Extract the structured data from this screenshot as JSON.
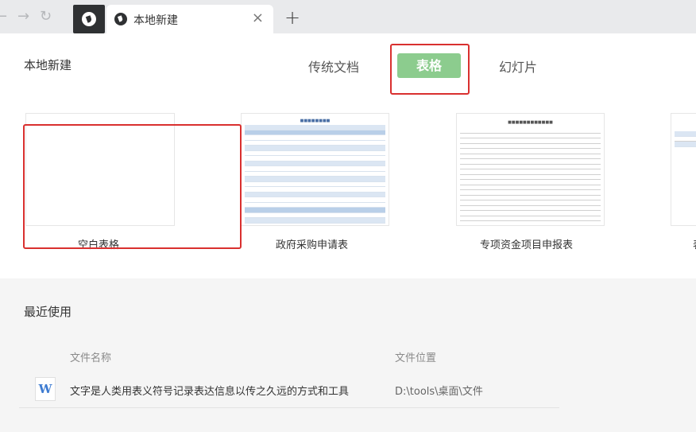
{
  "browser": {
    "tab_title": "本地新建",
    "icons": {
      "back": "back-arrow-icon",
      "forward": "forward-arrow-icon",
      "reload": "reload-icon",
      "close": "close-icon",
      "new_tab": "plus-icon"
    }
  },
  "header": {
    "title": "本地新建",
    "doc_tabs": [
      {
        "label": "传统文档"
      },
      {
        "label": "表格",
        "active": true
      },
      {
        "label": "幻灯片"
      }
    ]
  },
  "templates": [
    {
      "label": "空白表格"
    },
    {
      "label": "政府采购申请表"
    },
    {
      "label": "专项资金项目申报表"
    },
    {
      "label": "表"
    }
  ],
  "recent": {
    "title": "最近使用",
    "columns": {
      "name": "文件名称",
      "location": "文件位置"
    },
    "files": [
      {
        "icon_letter": "W",
        "name": "文字是人类用表义符号记录表达信息以传之久远的方式和工具",
        "path": "D:\\tools\\桌面\\文件"
      }
    ]
  },
  "colors": {
    "active_tab": "#8ccc8e",
    "highlight": "#d9302f",
    "word_icon": "#3d7bd1"
  }
}
